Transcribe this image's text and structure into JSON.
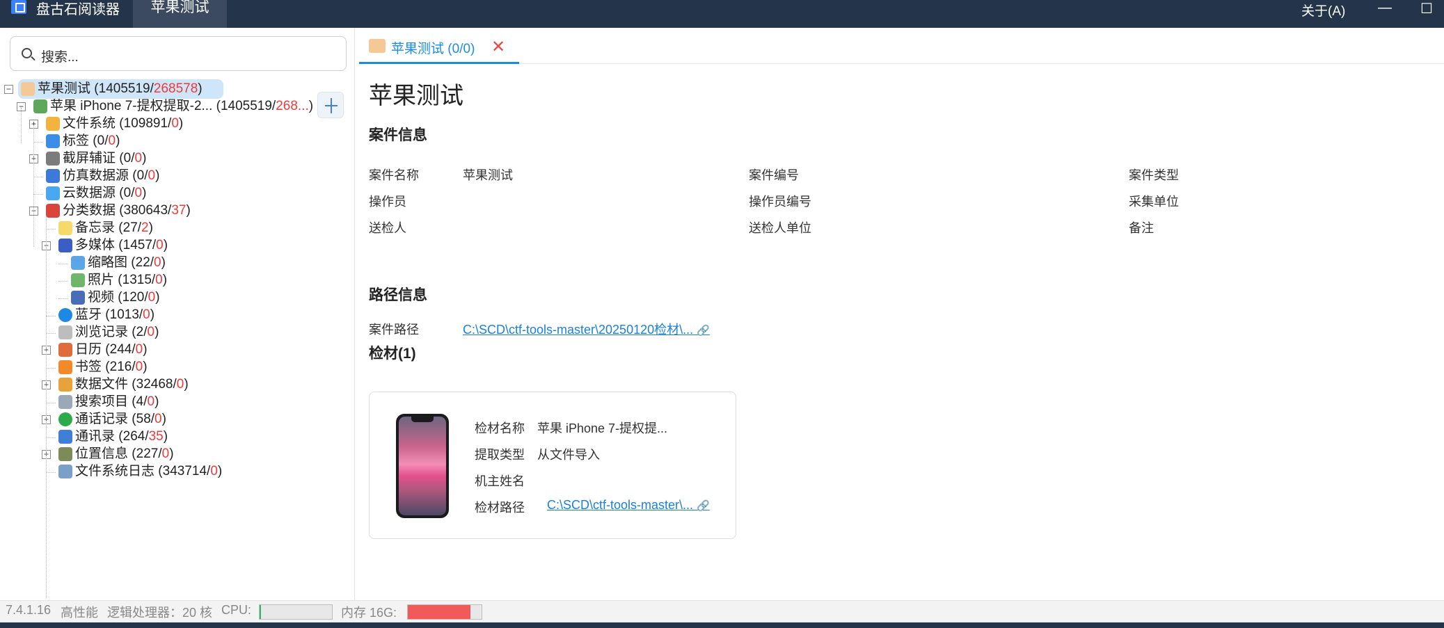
{
  "titlebar": {
    "app_name": "盘古石阅读器",
    "tab": "苹果测试",
    "about": "关于(A)",
    "minimize": "—",
    "maximize": "☐"
  },
  "search": {
    "placeholder": "搜索..."
  },
  "tree": [
    {
      "label": "苹果测试",
      "count": "1405519",
      "flagged": "268578",
      "icon": "case-folder-icon",
      "selected": true,
      "expander": "minus"
    },
    {
      "label": "苹果 iPhone 7-提权提取-2...",
      "count": "1405519",
      "flagged": "268...",
      "icon": "phone-icon",
      "expander": "minus"
    },
    {
      "label": "文件系统",
      "count": "109891",
      "flagged": "0",
      "icon": "folder-icon",
      "expander": "plus"
    },
    {
      "label": "标签",
      "count": "0",
      "flagged": "0",
      "icon": "tag-icon"
    },
    {
      "label": "截屏辅证",
      "count": "0",
      "flagged": "0",
      "icon": "camera-icon",
      "expander": "plus"
    },
    {
      "label": "仿真数据源",
      "count": "0",
      "flagged": "0",
      "icon": "emulate-icon"
    },
    {
      "label": "云数据源",
      "count": "0",
      "flagged": "0",
      "icon": "cloud-icon"
    },
    {
      "label": "分类数据",
      "count": "380643",
      "flagged": "37",
      "icon": "category-icon",
      "expander": "minus"
    },
    {
      "label": "备忘录",
      "count": "27",
      "flagged": "2",
      "icon": "notes-icon"
    },
    {
      "label": "多媒体",
      "count": "1457",
      "flagged": "0",
      "icon": "media-icon",
      "expander": "minus"
    },
    {
      "label": "缩略图",
      "count": "22",
      "flagged": "0",
      "icon": "thumbnail-icon"
    },
    {
      "label": "照片",
      "count": "1315",
      "flagged": "0",
      "icon": "photo-icon"
    },
    {
      "label": "视频",
      "count": "120",
      "flagged": "0",
      "icon": "video-icon"
    },
    {
      "label": "蓝牙",
      "count": "1013",
      "flagged": "0",
      "icon": "bluetooth-icon"
    },
    {
      "label": "浏览记录",
      "count": "2",
      "flagged": "0",
      "icon": "history-icon"
    },
    {
      "label": "日历",
      "count": "244",
      "flagged": "0",
      "icon": "calendar-icon",
      "expander": "plus"
    },
    {
      "label": "书签",
      "count": "216",
      "flagged": "0",
      "icon": "bookmark-icon"
    },
    {
      "label": "数据文件",
      "count": "32468",
      "flagged": "0",
      "icon": "database-icon",
      "expander": "plus"
    },
    {
      "label": "搜索项目",
      "count": "4",
      "flagged": "0",
      "icon": "search-item-icon"
    },
    {
      "label": "通话记录",
      "count": "58",
      "flagged": "0",
      "icon": "call-icon",
      "expander": "plus"
    },
    {
      "label": "通讯录",
      "count": "264",
      "flagged": "35",
      "icon": "contacts-icon"
    },
    {
      "label": "位置信息",
      "count": "227",
      "flagged": "0",
      "icon": "location-icon",
      "expander": "plus"
    },
    {
      "label": "文件系统日志",
      "count": "343714",
      "flagged": "0",
      "icon": "fslog-icon"
    }
  ],
  "content_tab": {
    "label": "苹果测试",
    "count": "0",
    "flagged": "0"
  },
  "case": {
    "title": "苹果测试",
    "section_case": "案件信息",
    "fields": [
      {
        "label": "案件名称",
        "value": "苹果测试"
      },
      {
        "label": "案件编号",
        "value": ""
      },
      {
        "label": "案件类型",
        "value": ""
      },
      {
        "label": "操作员",
        "value": ""
      },
      {
        "label": "操作员编号",
        "value": ""
      },
      {
        "label": "采集单位",
        "value": ""
      },
      {
        "label": "送检人",
        "value": ""
      },
      {
        "label": "送检人单位",
        "value": ""
      },
      {
        "label": "备注",
        "value": ""
      }
    ],
    "section_path": "路径信息",
    "path_label": "案件路径",
    "path_value": "C:\\SCD\\ctf-tools-master\\20250120检材\\...",
    "section_evidence": "检材(1)"
  },
  "evidence": {
    "name_label": "检材名称",
    "name_value": "苹果 iPhone 7-提权提...",
    "type_label": "提取类型",
    "type_value": "从文件导入",
    "owner_label": "机主姓名",
    "owner_value": "",
    "path_label": "检材路径",
    "path_value": "C:\\SCD\\ctf-tools-master\\..."
  },
  "statusbar": {
    "version": "7.4.1.16",
    "mode": "高性能",
    "cpu_cores": "逻辑处理器：20 核",
    "cpu_label": "CPU:",
    "cpu_usage": 0.02,
    "mem_label": "内存 16G:",
    "mem_usage": 0.85
  },
  "colors": {
    "titlebar": "#24354b",
    "accent": "#1a8ce0",
    "flagged": "#ee3a3a",
    "mem_fill": "#f05a5a",
    "cpu_fill": "#2bb673"
  }
}
